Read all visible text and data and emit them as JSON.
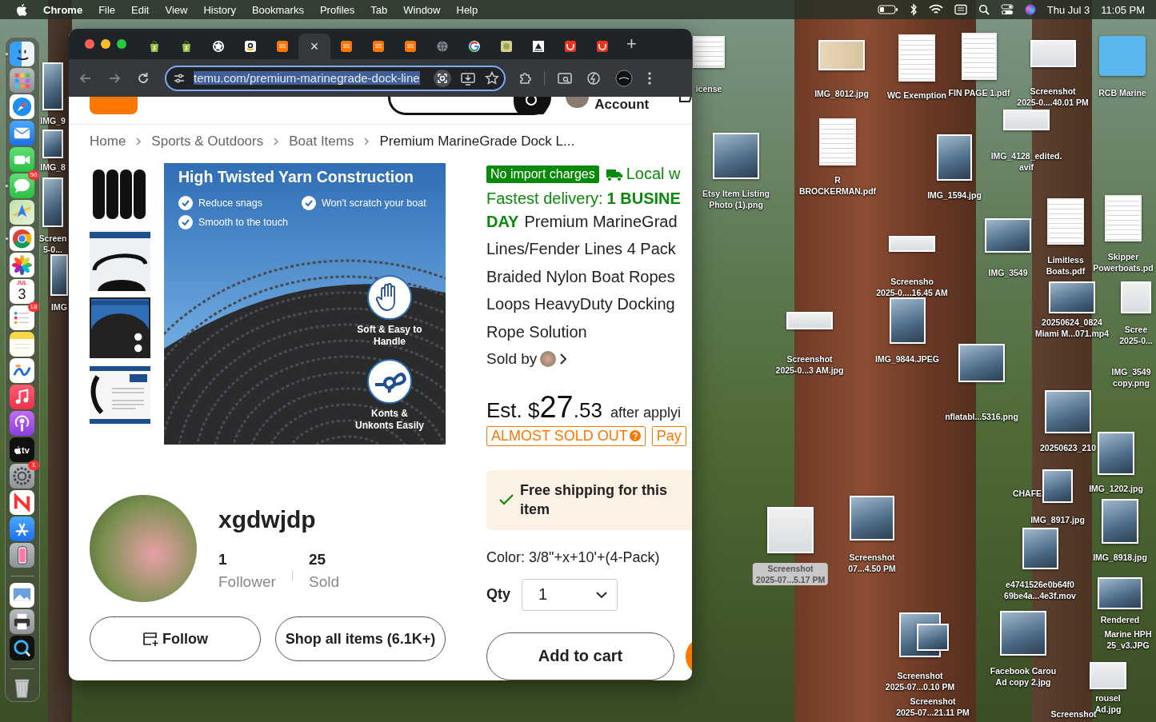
{
  "menu_bar": {
    "app": "Chrome",
    "menus": [
      "File",
      "Edit",
      "View",
      "History",
      "Bookmarks",
      "Profiles",
      "Tab",
      "Window",
      "Help"
    ],
    "date": "Thu Jul 3",
    "time": "11:05 PM"
  },
  "dock": {
    "items": [
      {
        "kind": "finder",
        "running": true
      },
      {
        "kind": "launchpad",
        "running": false
      },
      {
        "kind": "safari",
        "running": false
      },
      {
        "kind": "mail",
        "running": false
      },
      {
        "kind": "facetime",
        "running": false
      },
      {
        "kind": "messages",
        "running": true,
        "badge": "50"
      },
      {
        "kind": "maps",
        "running": false
      },
      {
        "kind": "chrome",
        "running": true
      },
      {
        "kind": "photos",
        "running": false
      },
      {
        "kind": "calendar",
        "running": false,
        "month": "JUL",
        "day": "3"
      },
      {
        "kind": "reminders",
        "running": false,
        "badge": "18"
      },
      {
        "kind": "notes",
        "running": false
      },
      {
        "kind": "freeform",
        "running": false
      },
      {
        "kind": "music",
        "running": false
      },
      {
        "kind": "podcasts",
        "running": false
      },
      {
        "kind": "tv",
        "running": false,
        "label": "tv"
      },
      {
        "kind": "settings",
        "running": false,
        "badge": "1"
      },
      {
        "kind": "news",
        "running": false
      },
      {
        "kind": "appstore",
        "running": false
      },
      {
        "kind": "iphone",
        "running": false
      },
      {
        "kind": "divider"
      },
      {
        "kind": "preview",
        "running": false
      },
      {
        "kind": "printer",
        "running": false
      },
      {
        "kind": "quicktime",
        "running": false
      },
      {
        "kind": "divider"
      },
      {
        "kind": "trash",
        "running": false
      }
    ]
  },
  "desktop": {
    "icons": [
      {
        "lines": [
          "IMG_9"
        ],
        "kind": "photo",
        "selected": false
      },
      {
        "lines": [
          "IMG_8"
        ],
        "kind": "photo",
        "selected": false
      },
      {
        "lines": [
          "Screen",
          "5-0..."
        ],
        "kind": "photo",
        "selected": false
      },
      {
        "lines": [
          "IMG"
        ],
        "kind": "photo",
        "selected": false
      },
      {
        "lines": [
          "icense"
        ],
        "kind": "document",
        "selected": false
      },
      {
        "lines": [
          "IMG_8012.jpg"
        ],
        "kind": "card",
        "selected": false
      },
      {
        "lines": [
          "WC Exemption"
        ],
        "kind": "document",
        "selected": false
      },
      {
        "lines": [
          "FIN PAGE 1.pdf"
        ],
        "kind": "document",
        "selected": false
      },
      {
        "lines": [
          "Screenshot",
          "2025-0....40.01 PM"
        ],
        "kind": "screenshot",
        "selected": false
      },
      {
        "lines": [
          "RCB Marine"
        ],
        "kind": "folder",
        "selected": false
      },
      {
        "lines": [
          "IMG_4128_edited.",
          "avif"
        ],
        "kind": "screenshot",
        "selected": false
      },
      {
        "lines": [
          "Etsy Item Listing",
          "Photo (1).png"
        ],
        "kind": "photo",
        "selected": false
      },
      {
        "lines": [
          "R",
          "BROCKERMAN.pdf"
        ],
        "kind": "document",
        "selected": false
      },
      {
        "lines": [
          "IMG_1594.jpg"
        ],
        "kind": "photo",
        "selected": false
      },
      {
        "lines": [
          "Limitless",
          "Boats.pdf"
        ],
        "kind": "document",
        "selected": false
      },
      {
        "lines": [
          "Skipper",
          "Powerboats.pd"
        ],
        "kind": "document",
        "selected": false
      },
      {
        "lines": [
          "IMG_3549"
        ],
        "kind": "photo",
        "selected": false
      },
      {
        "lines": [
          "Screensho",
          "2025-0....16.45 AM"
        ],
        "kind": "screenshot",
        "selected": false
      },
      {
        "lines": [
          "Screenshot",
          "2025-0...3 AM.jpg"
        ],
        "kind": "screenshot",
        "selected": false
      },
      {
        "lines": [
          "IMG_9844.JPEG"
        ],
        "kind": "photo",
        "selected": false
      },
      {
        "lines": [
          "20250624_0824",
          "Miami M...071.mp4"
        ],
        "kind": "photo",
        "selected": false
      },
      {
        "lines": [
          "Scree",
          "2025-0..."
        ],
        "kind": "screenshot",
        "selected": false
      },
      {
        "lines": [
          "IMG_3549",
          "copy.png"
        ],
        "kind": "none",
        "selected": false
      },
      {
        "lines": [
          "nflatabl...5316.png"
        ],
        "kind": "photo",
        "selected": false
      },
      {
        "lines": [
          "20250623_210"
        ],
        "kind": "photo",
        "selected": false
      },
      {
        "lines": [
          "IMG_1202.jpg"
        ],
        "kind": "photo",
        "selected": false
      },
      {
        "lines": [
          "CHAFE"
        ],
        "kind": "none",
        "selected": false
      },
      {
        "lines": [
          "IMG_8917.jpg"
        ],
        "kind": "photo",
        "selected": false
      },
      {
        "lines": [
          "IMG_8918.jpg"
        ],
        "kind": "photo",
        "selected": false
      },
      {
        "lines": [
          "e4741526e0b64f0",
          "69be4a...4e3f.mov"
        ],
        "kind": "photo",
        "selected": false
      },
      {
        "lines": [
          "Rendered"
        ],
        "kind": "photo",
        "selected": false
      },
      {
        "lines": [
          "Marine HPH",
          "25_v3.JPG"
        ],
        "kind": "none",
        "selected": false
      },
      {
        "lines": [
          "Facebook Carou",
          "Ad copy 2.jpg"
        ],
        "kind": "photo",
        "selected": false
      },
      {
        "lines": [
          "rousel",
          "Ad.jpg"
        ],
        "kind": "screenshot",
        "selected": false
      },
      {
        "lines": [
          "Screenshot"
        ],
        "kind": "none",
        "selected": false
      },
      {
        "lines": [
          "Screenshot",
          "07...4.50 PM"
        ],
        "kind": "photo",
        "selected": false
      },
      {
        "lines": [
          "Screenshot",
          "2025-07...5.17 PM"
        ],
        "kind": "screenshot",
        "selected": true
      },
      {
        "lines": [
          "Screenshot",
          "2025-07...0.10 PM"
        ],
        "kind": "photo",
        "selected": false
      },
      {
        "lines": [
          "Screenshot",
          "2025-07...21.11 PM"
        ],
        "kind": "photo",
        "selected": false
      }
    ]
  },
  "browser": {
    "tabs": [
      {
        "kind": "shopify",
        "selected": false
      },
      {
        "kind": "shopify",
        "selected": false
      },
      {
        "kind": "knot",
        "selected": false
      },
      {
        "kind": "amazon",
        "selected": false
      },
      {
        "kind": "temu",
        "selected": false
      },
      {
        "selected": true,
        "close": "×"
      },
      {
        "kind": "temu",
        "selected": false
      },
      {
        "kind": "temu",
        "selected": false
      },
      {
        "kind": "temu",
        "selected": false
      },
      {
        "kind": "globe",
        "selected": false
      },
      {
        "kind": "google",
        "selected": false
      },
      {
        "kind": "image",
        "selected": false
      },
      {
        "kind": "logo",
        "selected": false
      },
      {
        "kind": "red",
        "selected": false
      },
      {
        "kind": "red",
        "selected": false
      }
    ],
    "new_tab": "+",
    "address": {
      "url": "temu.com/premium-marinegrade-dock-line",
      "selected": true
    }
  },
  "page": {
    "header": {
      "account": "Account"
    },
    "breadcrumb": [
      "Home",
      "Sports & Outdoors",
      "Boat Items",
      "Premium MarineGrade Dock L..."
    ],
    "thumbnails": [
      {
        "kind": "ropes",
        "selected": false
      },
      {
        "kind": "diagram",
        "selected": false
      },
      {
        "kind": "banner",
        "selected": true
      },
      {
        "kind": "text",
        "selected": false
      }
    ],
    "product_image": {
      "title": "High Twisted Yarn Construction",
      "checks": [
        "Reduce snags",
        "Won't scratch your boat",
        "Smooth to the touch"
      ],
      "badges": [
        {
          "kind": "hand",
          "label": "Soft & Easy to Handle"
        },
        {
          "kind": "knot",
          "label": "Konts & Unkonts Easily"
        }
      ]
    },
    "badge": "No import charges",
    "local": "Local w",
    "delivery": {
      "prefix": "Fastest delivery:",
      "days": "1 BUSINE",
      "days_end": "DAY"
    },
    "title_lines": [
      "Premium MarineGrad",
      "Lines/Fender Lines 4 Pack",
      "Braided Nylon Boat Ropes",
      "Loops HeavyDuty Docking",
      "Rope Solution"
    ],
    "sold_by": "Sold by",
    "price": {
      "prefix": "Est. $",
      "whole": "27",
      "cents": ".53",
      "note": "after applyi"
    },
    "tags": [
      {
        "kind": "stock",
        "label": "ALMOST SOLD OUT"
      },
      {
        "kind": "pay",
        "label": "Pay"
      }
    ],
    "shipping": "Free shipping for this item",
    "color_option": "Color: 3/8\"+x+10'+(4-Pack)",
    "qty": {
      "label": "Qty",
      "value": "1"
    },
    "cart": "Add to cart",
    "seller": {
      "name": "xgdwjdp",
      "stats": [
        {
          "value": "1",
          "label": "Follower"
        },
        {
          "value": "25",
          "label": "Sold"
        }
      ],
      "buttons": [
        {
          "kind": "follow",
          "label": "Follow"
        },
        {
          "kind": "shop",
          "label": "Shop all items (6.1K+)"
        }
      ]
    }
  }
}
